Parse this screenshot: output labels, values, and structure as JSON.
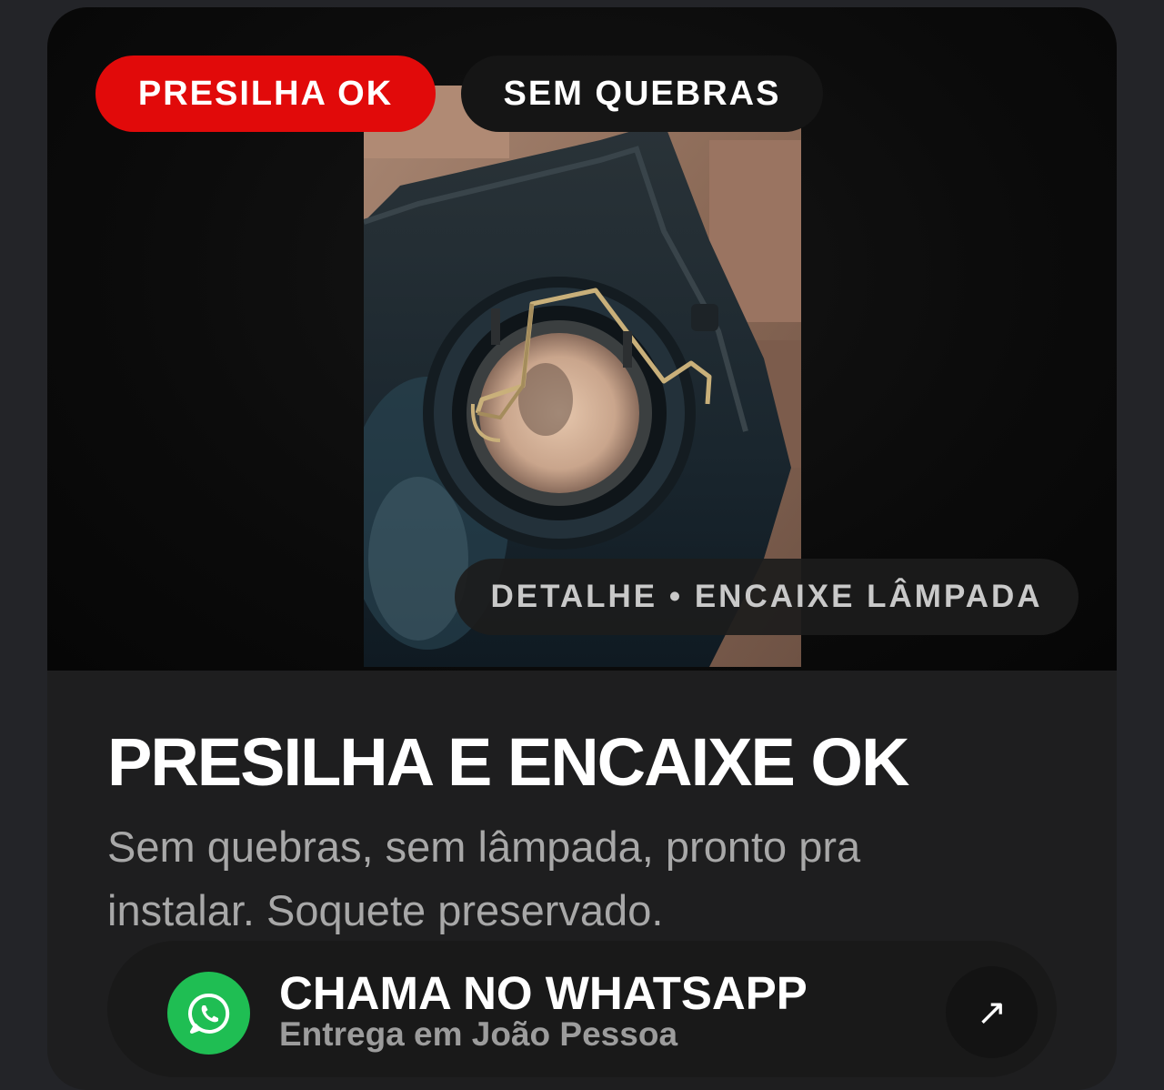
{
  "badges": {
    "primary": "PRESILHA OK",
    "secondary": "SEM QUEBRAS"
  },
  "image": {
    "caption": "DETALHE • ENCAIXE LÂMPADA",
    "subject": "headlight bulb socket with metal clip"
  },
  "product": {
    "title": "PRESILHA E ENCAIXE OK",
    "description": "Sem quebras, sem lâmpada, pronto pra instalar. Soquete preservado."
  },
  "cta": {
    "label": "CHAMA NO WHATSAPP",
    "sublabel": "Entrega em João Pessoa",
    "icon": "whatsapp-icon",
    "arrow_icon": "arrow-up-right-icon",
    "arrow_glyph": "↗"
  },
  "colors": {
    "accent_red": "#e10a0a",
    "whatsapp_green": "#1fbe53",
    "card_bg": "#1e1e1f"
  }
}
